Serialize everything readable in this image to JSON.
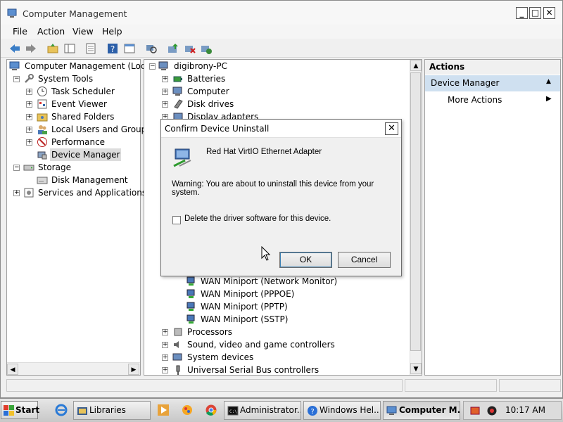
{
  "window": {
    "title": "Computer Management",
    "menu": [
      "File",
      "Action",
      "View",
      "Help"
    ]
  },
  "tree": [
    {
      "label": "Computer Management (Local",
      "icon": "computer-management-icon"
    },
    {
      "label": "System Tools",
      "icon": "tools-icon"
    },
    {
      "label": "Task Scheduler",
      "icon": "clock-icon"
    },
    {
      "label": "Event Viewer",
      "icon": "event-viewer-icon"
    },
    {
      "label": "Shared Folders",
      "icon": "shared-folder-icon"
    },
    {
      "label": "Local Users and Groups",
      "icon": "users-icon"
    },
    {
      "label": "Performance",
      "icon": "performance-icon"
    },
    {
      "label": "Device Manager",
      "icon": "device-manager-icon"
    },
    {
      "label": "Storage",
      "icon": "storage-icon"
    },
    {
      "label": "Disk Management",
      "icon": "disk-icon"
    },
    {
      "label": "Services and Applications",
      "icon": "services-icon"
    }
  ],
  "devices": {
    "root": "digibrony-PC",
    "top_items": [
      "Batteries",
      "Computer",
      "Disk drives",
      "Display adapters"
    ],
    "wan_items": [
      "WAN Miniport (Network Monitor)",
      "WAN Miniport (PPPOE)",
      "WAN Miniport (PPTP)",
      "WAN Miniport (SSTP)"
    ],
    "bottom_items": [
      "Processors",
      "Sound, video and game controllers",
      "System devices",
      "Universal Serial Bus controllers"
    ]
  },
  "actions": {
    "header": "Actions",
    "section": "Device Manager",
    "more": "More Actions"
  },
  "dialog": {
    "title": "Confirm Device Uninstall",
    "device_name": "Red Hat VirtIO Ethernet Adapter",
    "warning": "Warning: You are about to uninstall this device from your system.",
    "checkbox_label": "Delete the driver software for this device.",
    "checkbox_checked": false,
    "ok": "OK",
    "cancel": "Cancel"
  },
  "taskbar": {
    "start": "Start",
    "items": [
      "Libraries",
      "Administrator...",
      "Windows Hel...",
      "Computer M..."
    ],
    "clock": "10:17 AM"
  }
}
